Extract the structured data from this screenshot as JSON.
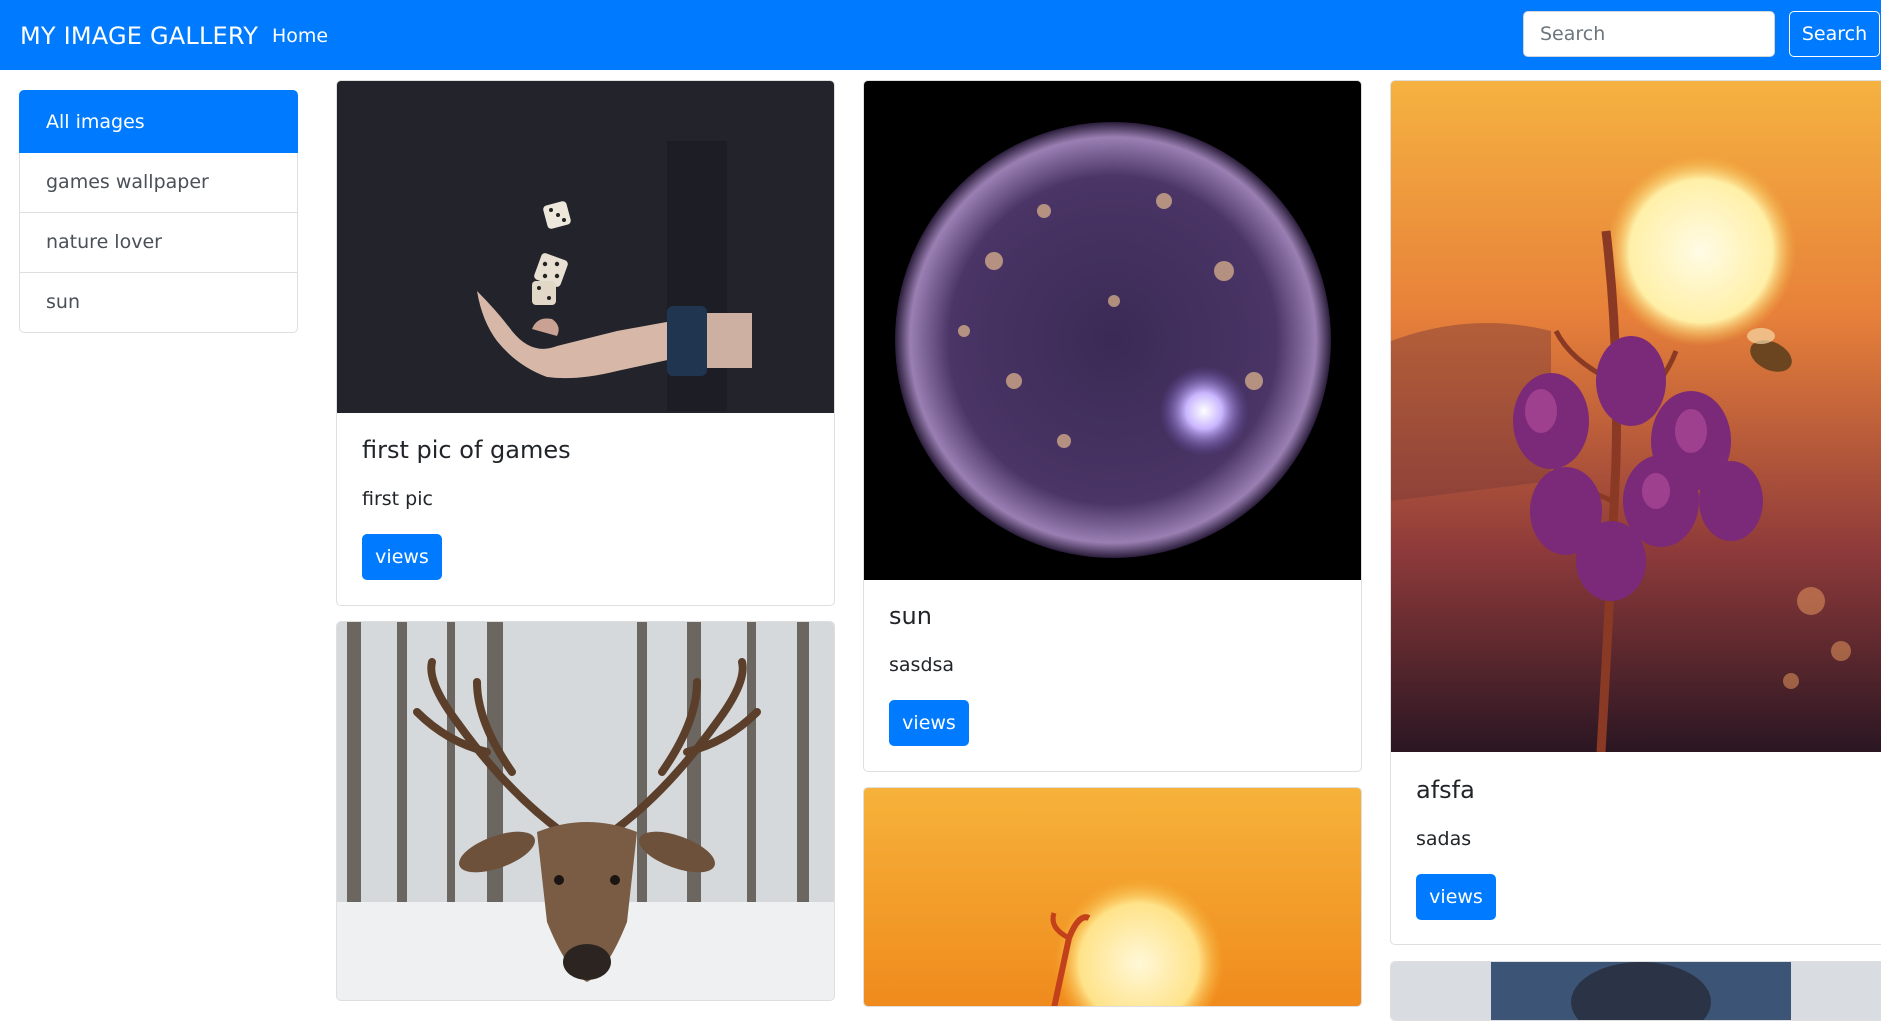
{
  "navbar": {
    "brand": "MY IMAGE GALLERY",
    "home_label": "Home",
    "search_placeholder": "Search",
    "search_button": "Search",
    "color": "#007bff"
  },
  "sidebar": {
    "items": [
      {
        "label": "All images",
        "active": true
      },
      {
        "label": "games wallpaper",
        "active": false
      },
      {
        "label": "nature lover",
        "active": false
      },
      {
        "label": "sun",
        "active": false
      }
    ]
  },
  "cards": [
    {
      "title": "first pic of games",
      "text": "first pic",
      "button": "views",
      "image": "dice-hand-photo"
    },
    {
      "title": "sun",
      "text": "sasdsa",
      "button": "views",
      "image": "sun-surface-photo"
    },
    {
      "title": "afsfa",
      "text": "sadas",
      "button": "views",
      "image": "flower-sunset-photo"
    },
    {
      "image": "deer-snow-photo"
    },
    {
      "image": "sunset-plant-photo"
    },
    {
      "image": "portrait-photo"
    }
  ]
}
